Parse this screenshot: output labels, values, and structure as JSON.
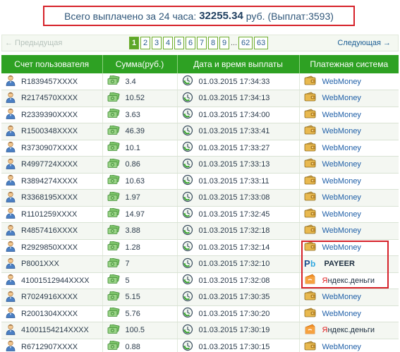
{
  "summary": {
    "prefix": "Всего выплачено за 24 часа:",
    "amount": "32255.34",
    "currency": "руб.",
    "payouts": "(Выплат:3593)"
  },
  "pager": {
    "prev_label": "← Предыдущая",
    "next_label": "Следующая →",
    "pages": [
      "1",
      "2",
      "3",
      "4",
      "5",
      "6",
      "7",
      "8",
      "9"
    ],
    "dots": "...",
    "last_pages": [
      "62",
      "63"
    ],
    "active": "1"
  },
  "table": {
    "headers": [
      "Счет пользователя",
      "Сумма(руб.)",
      "Дата и время выплаты",
      "Платежная система"
    ],
    "rows": [
      {
        "account": "R1839457XXXX",
        "sum": "3.4",
        "date": "01.03.2015 17:34:33",
        "system": "WebMoney",
        "system_type": "webmoney"
      },
      {
        "account": "R2174570XXXX",
        "sum": "10.52",
        "date": "01.03.2015 17:34:13",
        "system": "WebMoney",
        "system_type": "webmoney"
      },
      {
        "account": "R2339390XXXX",
        "sum": "3.63",
        "date": "01.03.2015 17:34:00",
        "system": "WebMoney",
        "system_type": "webmoney"
      },
      {
        "account": "R1500348XXXX",
        "sum": "46.39",
        "date": "01.03.2015 17:33:41",
        "system": "WebMoney",
        "system_type": "webmoney"
      },
      {
        "account": "R3730907XXXX",
        "sum": "10.1",
        "date": "01.03.2015 17:33:27",
        "system": "WebMoney",
        "system_type": "webmoney"
      },
      {
        "account": "R4997724XXXX",
        "sum": "0.86",
        "date": "01.03.2015 17:33:13",
        "system": "WebMoney",
        "system_type": "webmoney"
      },
      {
        "account": "R3894274XXXX",
        "sum": "10.63",
        "date": "01.03.2015 17:33:11",
        "system": "WebMoney",
        "system_type": "webmoney"
      },
      {
        "account": "R3368195XXXX",
        "sum": "1.97",
        "date": "01.03.2015 17:33:08",
        "system": "WebMoney",
        "system_type": "webmoney"
      },
      {
        "account": "R1101259XXXX",
        "sum": "14.97",
        "date": "01.03.2015 17:32:45",
        "system": "WebMoney",
        "system_type": "webmoney"
      },
      {
        "account": "R4857416XXXX",
        "sum": "3.88",
        "date": "01.03.2015 17:32:18",
        "system": "WebMoney",
        "system_type": "webmoney"
      },
      {
        "account": "R2929850XXXX",
        "sum": "1.28",
        "date": "01.03.2015 17:32:14",
        "system": "WebMoney",
        "system_type": "webmoney"
      },
      {
        "account": "P8001XXX",
        "sum": "7",
        "date": "01.03.2015 17:32:10",
        "system": "PAYEER",
        "system_type": "payeer"
      },
      {
        "account": "41001512944XXXX",
        "sum": "5",
        "date": "01.03.2015 17:32:08",
        "system": "Яндекс.деньги",
        "system_type": "yandex"
      },
      {
        "account": "R7024916XXXX",
        "sum": "5.15",
        "date": "01.03.2015 17:30:35",
        "system": "WebMoney",
        "system_type": "webmoney"
      },
      {
        "account": "R2001304XXXX",
        "sum": "5.76",
        "date": "01.03.2015 17:30:20",
        "system": "WebMoney",
        "system_type": "webmoney"
      },
      {
        "account": "41001154214XXXX",
        "sum": "100.5",
        "date": "01.03.2015 17:30:19",
        "system": "Яндекс.деньги",
        "system_type": "yandex"
      },
      {
        "account": "R6712907XXXX",
        "sum": "0.88",
        "date": "01.03.2015 17:30:15",
        "system": "WebMoney",
        "system_type": "webmoney"
      }
    ]
  },
  "icons": {
    "account": "user-icon",
    "sum": "money-icon",
    "date": "clock-refresh-icon",
    "webmoney": "webmoney-wallet-icon",
    "payeer": "payeer-logo-icon",
    "yandex": "yandex-money-icon"
  },
  "colors": {
    "header_green": "#2ea123",
    "highlight_red": "#d6222a",
    "link_blue": "#2060a8"
  }
}
